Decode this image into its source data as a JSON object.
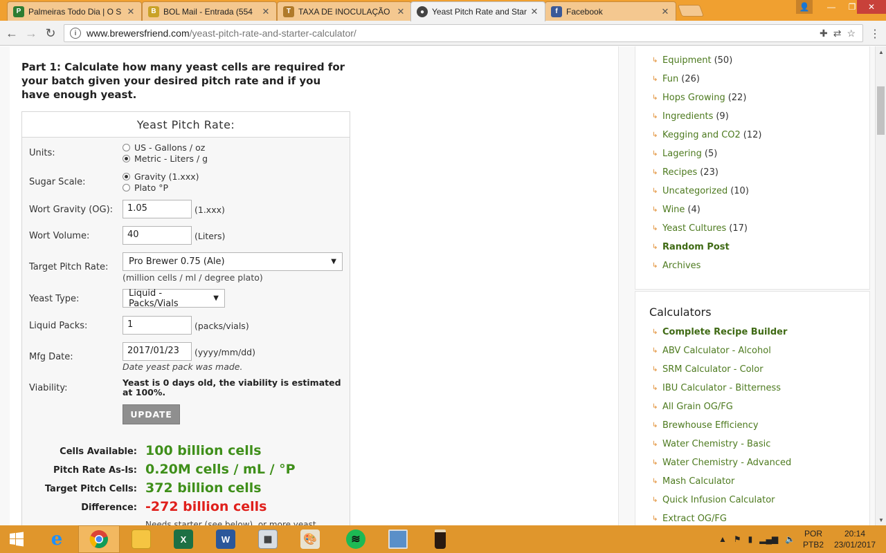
{
  "browser": {
    "tabs": [
      {
        "label": "Palmeiras Todo Dia | O S",
        "favicon": "palmeiras-icon",
        "color": "#2e7d32"
      },
      {
        "label": "BOL Mail - Entrada (554",
        "favicon": "bol-mail-icon",
        "color": "#c9a227"
      },
      {
        "label": "TAXA DE INOCULAÇÃO",
        "favicon": "beer-icon",
        "color": "#b07a2a"
      },
      {
        "label": "Yeast Pitch Rate and Star",
        "favicon": "brewersfriend-icon",
        "color": "#444444"
      },
      {
        "label": "Facebook",
        "favicon": "facebook-icon",
        "color": "#3b5998"
      }
    ],
    "url_domain": "www.brewersfriend.com",
    "url_path": "/yeast-pitch-rate-and-starter-calculator/"
  },
  "page": {
    "intro": "Part 1: Calculate how many yeast cells are required for your batch given your desired pitch rate and if you have enough yeast.",
    "calc": {
      "title": "Yeast Pitch Rate:",
      "units_label": "Units:",
      "units_options": [
        "US - Gallons / oz",
        "Metric - Liters / g"
      ],
      "sugar_label": "Sugar Scale:",
      "sugar_options": [
        "Gravity (1.xxx)",
        "Plato °P"
      ],
      "og_label": "Wort Gravity (OG):",
      "og_value": "1.05",
      "og_unit": "(1.xxx)",
      "volume_label": "Wort Volume:",
      "volume_value": "40",
      "volume_unit": "(Liters)",
      "pitch_label": "Target Pitch Rate:",
      "pitch_value": "Pro Brewer 0.75 (Ale)",
      "pitch_hint": "(million cells / ml / degree plato)",
      "yeast_type_label": "Yeast Type:",
      "yeast_type_value": "Liquid - Packs/Vials",
      "packs_label": "Liquid Packs:",
      "packs_value": "1",
      "packs_unit": "(packs/vials)",
      "mfg_label": "Mfg Date:",
      "mfg_value": "2017/01/23",
      "mfg_unit": "(yyyy/mm/dd)",
      "mfg_hint": "Date yeast pack was made.",
      "viability_label": "Viability:",
      "viability_text": "Yeast is 0 days old, the viability is estimated at 100%.",
      "update_button": "UPDATE",
      "results": [
        {
          "label": "Cells Available:",
          "value": "100 billion cells",
          "color": "#3f8f1a"
        },
        {
          "label": "Pitch Rate As-Is:",
          "value": "0.20M cells / mL / °P",
          "color": "#3f8f1a"
        },
        {
          "label": "Target Pitch Cells:",
          "value": "372 billion cells",
          "color": "#3f8f1a"
        },
        {
          "label": "Difference:",
          "value": "-272 billion cells",
          "color": "#e0201c"
        }
      ],
      "results_note": "Needs starter (see below), or more yeast."
    }
  },
  "sidebar": {
    "categories": [
      {
        "name": "Equipment",
        "count": "(50)"
      },
      {
        "name": "Fun",
        "count": "(26)"
      },
      {
        "name": "Hops Growing",
        "count": "(22)"
      },
      {
        "name": "Ingredients",
        "count": "(9)"
      },
      {
        "name": "Kegging and CO2",
        "count": "(12)"
      },
      {
        "name": "Lagering",
        "count": "(5)"
      },
      {
        "name": "Recipes",
        "count": "(23)"
      },
      {
        "name": "Uncategorized",
        "count": "(10)"
      },
      {
        "name": "Wine",
        "count": "(4)"
      },
      {
        "name": "Yeast Cultures",
        "count": "(17)"
      },
      {
        "name": "Random Post",
        "count": ""
      },
      {
        "name": "Archives",
        "count": ""
      }
    ],
    "calculators_title": "Calculators",
    "calculators": [
      "Complete Recipe Builder",
      "ABV Calculator - Alcohol",
      "SRM Calculator - Color",
      "IBU Calculator - Bitterness",
      "All Grain OG/FG",
      "Brewhouse Efficiency",
      "Water Chemistry - Basic",
      "Water Chemistry - Advanced",
      "Mash Calculator",
      "Quick Infusion Calculator",
      "Extract OG/FG"
    ]
  },
  "taskbar": {
    "apps": [
      "start-icon",
      "internet-explorer-icon",
      "chrome-icon",
      "file-explorer-icon",
      "excel-icon",
      "word-icon",
      "calculator-icon",
      "paint-icon",
      "spotify-icon",
      "photos-icon",
      "beer-glass-icon"
    ],
    "lang_1": "POR",
    "lang_2": "PTB2",
    "time": "20:14",
    "date": "23/01/2017"
  }
}
